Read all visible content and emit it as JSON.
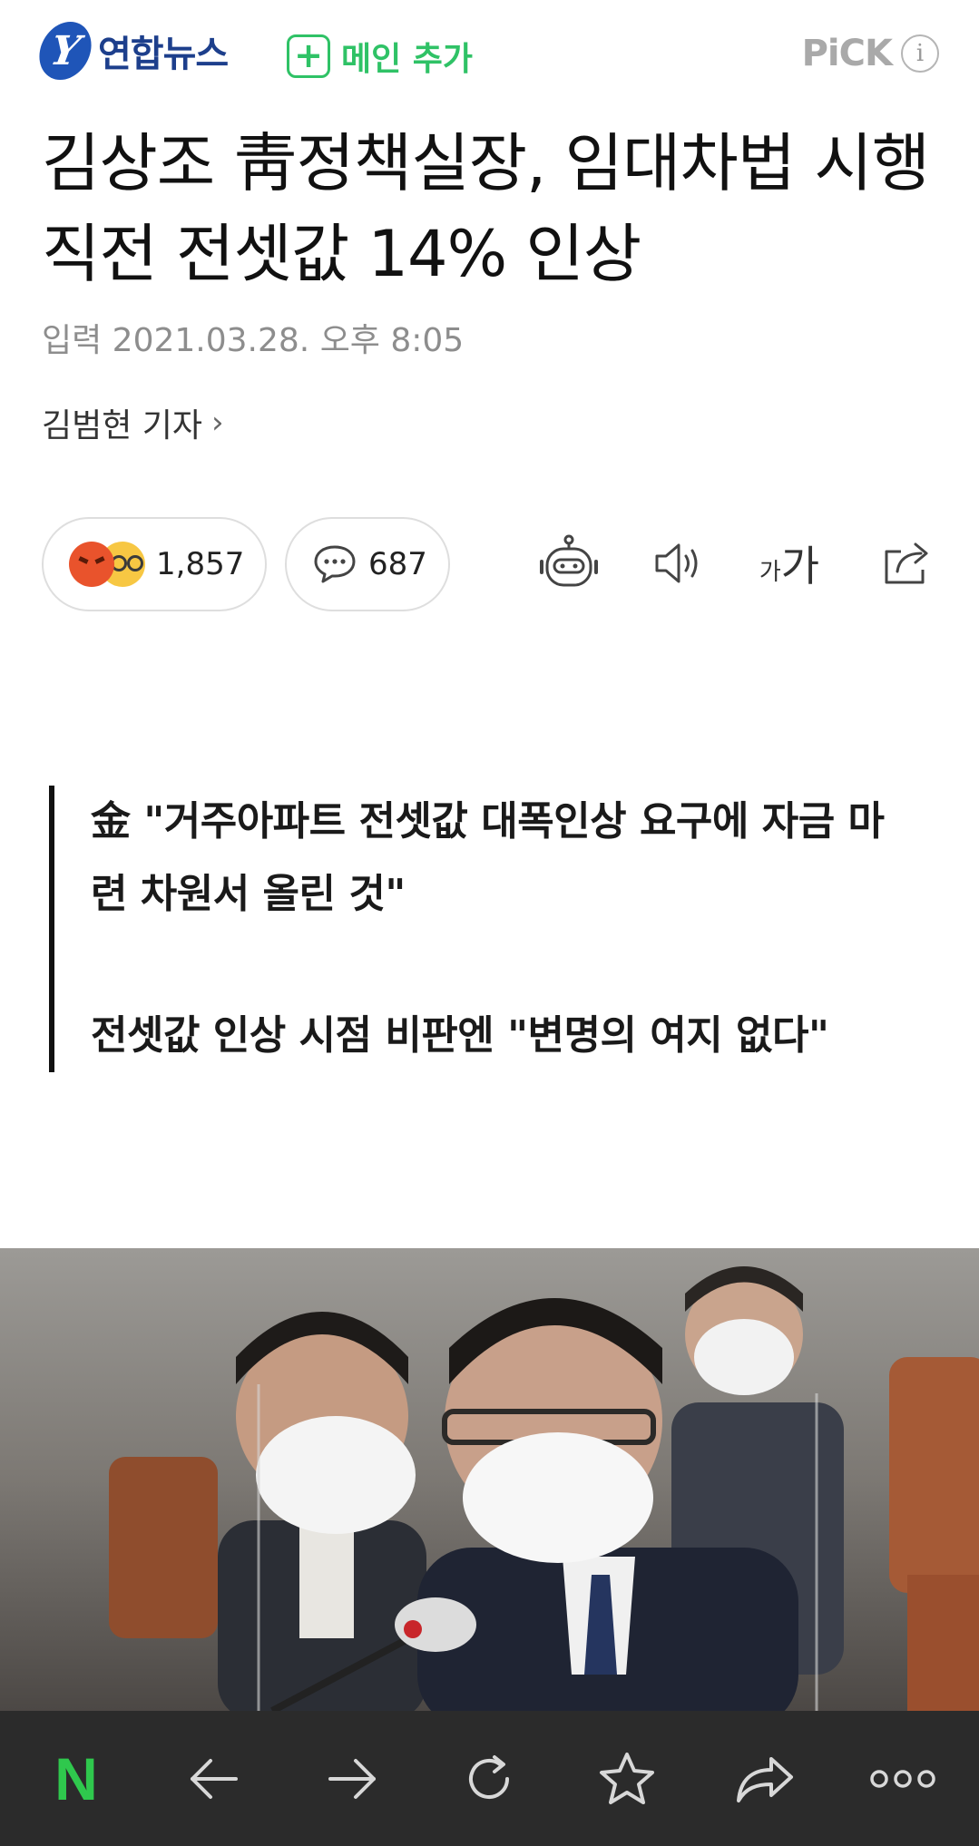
{
  "header": {
    "brand": "연합뉴스",
    "logo_glyph": "Y",
    "main_add_label": "메인 추가",
    "pick_label": "PiCK",
    "info_glyph": "i",
    "accent": "#2fc266",
    "brand_color": "#1d3f8c"
  },
  "article": {
    "title": "김상조 靑정책실장, 임대차법 시행 직전 전셋값 14% 인상",
    "date": "입력 2021.03.28. 오후 8:05",
    "reporter": "김범현 기자"
  },
  "reactions": {
    "count": "1,857",
    "icons": [
      "angry-emoji",
      "surprised-emoji"
    ]
  },
  "comments": {
    "count": "687"
  },
  "tools": {
    "font_small": "가",
    "font_big": "가",
    "icons": [
      "robot-icon",
      "speaker-icon",
      "font-size-icon",
      "share-icon"
    ]
  },
  "summary": {
    "line1": "金 \"거주아파트 전셋값 대폭인상 요구에 자금 마련 차원서 올린 것\"",
    "line2": "전셋값 인상 시점 비판엔 \"변명의 여지 없다\""
  },
  "bottom_nav": {
    "logo": "N",
    "logo_color": "#2fc84d",
    "icons": [
      "back-arrow-icon",
      "forward-arrow-icon",
      "refresh-icon",
      "bookmark-star-icon",
      "share-arrow-icon",
      "more-icon"
    ]
  }
}
